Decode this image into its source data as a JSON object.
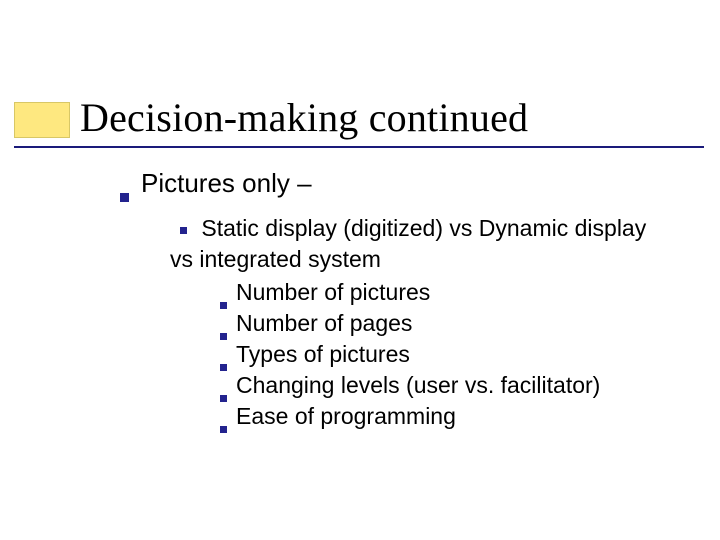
{
  "title": "Decision-making continued",
  "l1": "Pictures only –",
  "l2_line1": "Static display (digitized) vs Dynamic display",
  "l2_line2": "vs integrated system",
  "l3": {
    "a": "Number of pictures",
    "b": "Number of pages",
    "c": "Types of pictures",
    "d": "Changing levels (user vs. facilitator)",
    "e": "Ease of programming"
  }
}
